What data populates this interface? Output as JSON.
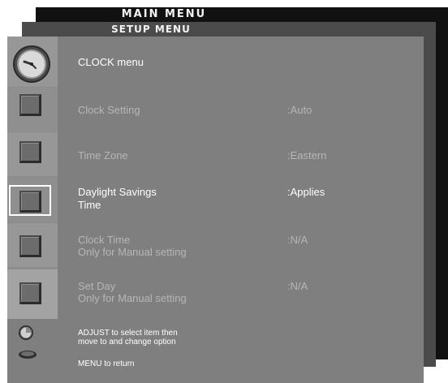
{
  "main_menu": {
    "title": "MAIN MENU"
  },
  "setup_menu": {
    "title": "SETUP MENU"
  },
  "clock_menu": {
    "title": "CLOCK menu",
    "items": [
      {
        "label_line1": "Clock Setting",
        "label_line2": "",
        "value": ":Auto",
        "selected": false
      },
      {
        "label_line1": "Time Zone",
        "label_line2": "",
        "value": ":Eastern",
        "selected": false
      },
      {
        "label_line1": "Daylight Savings",
        "label_line2": "Time",
        "value": ":Applies",
        "selected": true
      },
      {
        "label_line1": "Clock Time",
        "label_line2": "Only for Manual setting",
        "value": ":N/A",
        "selected": false
      },
      {
        "label_line1": "Set Day",
        "label_line2": "Only for Manual setting",
        "value": ":N/A",
        "selected": false
      }
    ]
  },
  "help": {
    "adjust_line1": "ADJUST to select item then",
    "adjust_line2": "move to and change option",
    "menu": "MENU to return"
  },
  "icons": {
    "clock": "clock-icon",
    "item": "square-icon",
    "adjust": "adjust-knob-icon",
    "menu": "menu-button-icon"
  },
  "colors": {
    "panel": "#7f7f7f",
    "setup_layer": "#4b4b4b",
    "main_layer": "#111111",
    "active_text": "#ffffff",
    "inactive_text": "#b6b6b6"
  }
}
